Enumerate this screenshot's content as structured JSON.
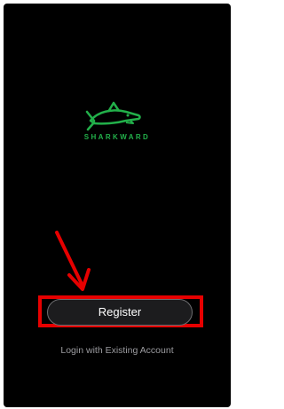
{
  "app": {
    "brand_name": "SHARKWARD",
    "logo_icon": "shark-icon"
  },
  "actions": {
    "register_label": "Register",
    "login_label": "Login with Existing Account"
  },
  "annotation": {
    "highlight_target": "register-button",
    "arrow_icon": "arrow-down-right-icon",
    "highlight_color": "#e60000"
  },
  "colors": {
    "background": "#000000",
    "brand": "#22b04a",
    "button_bg": "#1c1c1e",
    "link_text": "#9c9ca0"
  }
}
